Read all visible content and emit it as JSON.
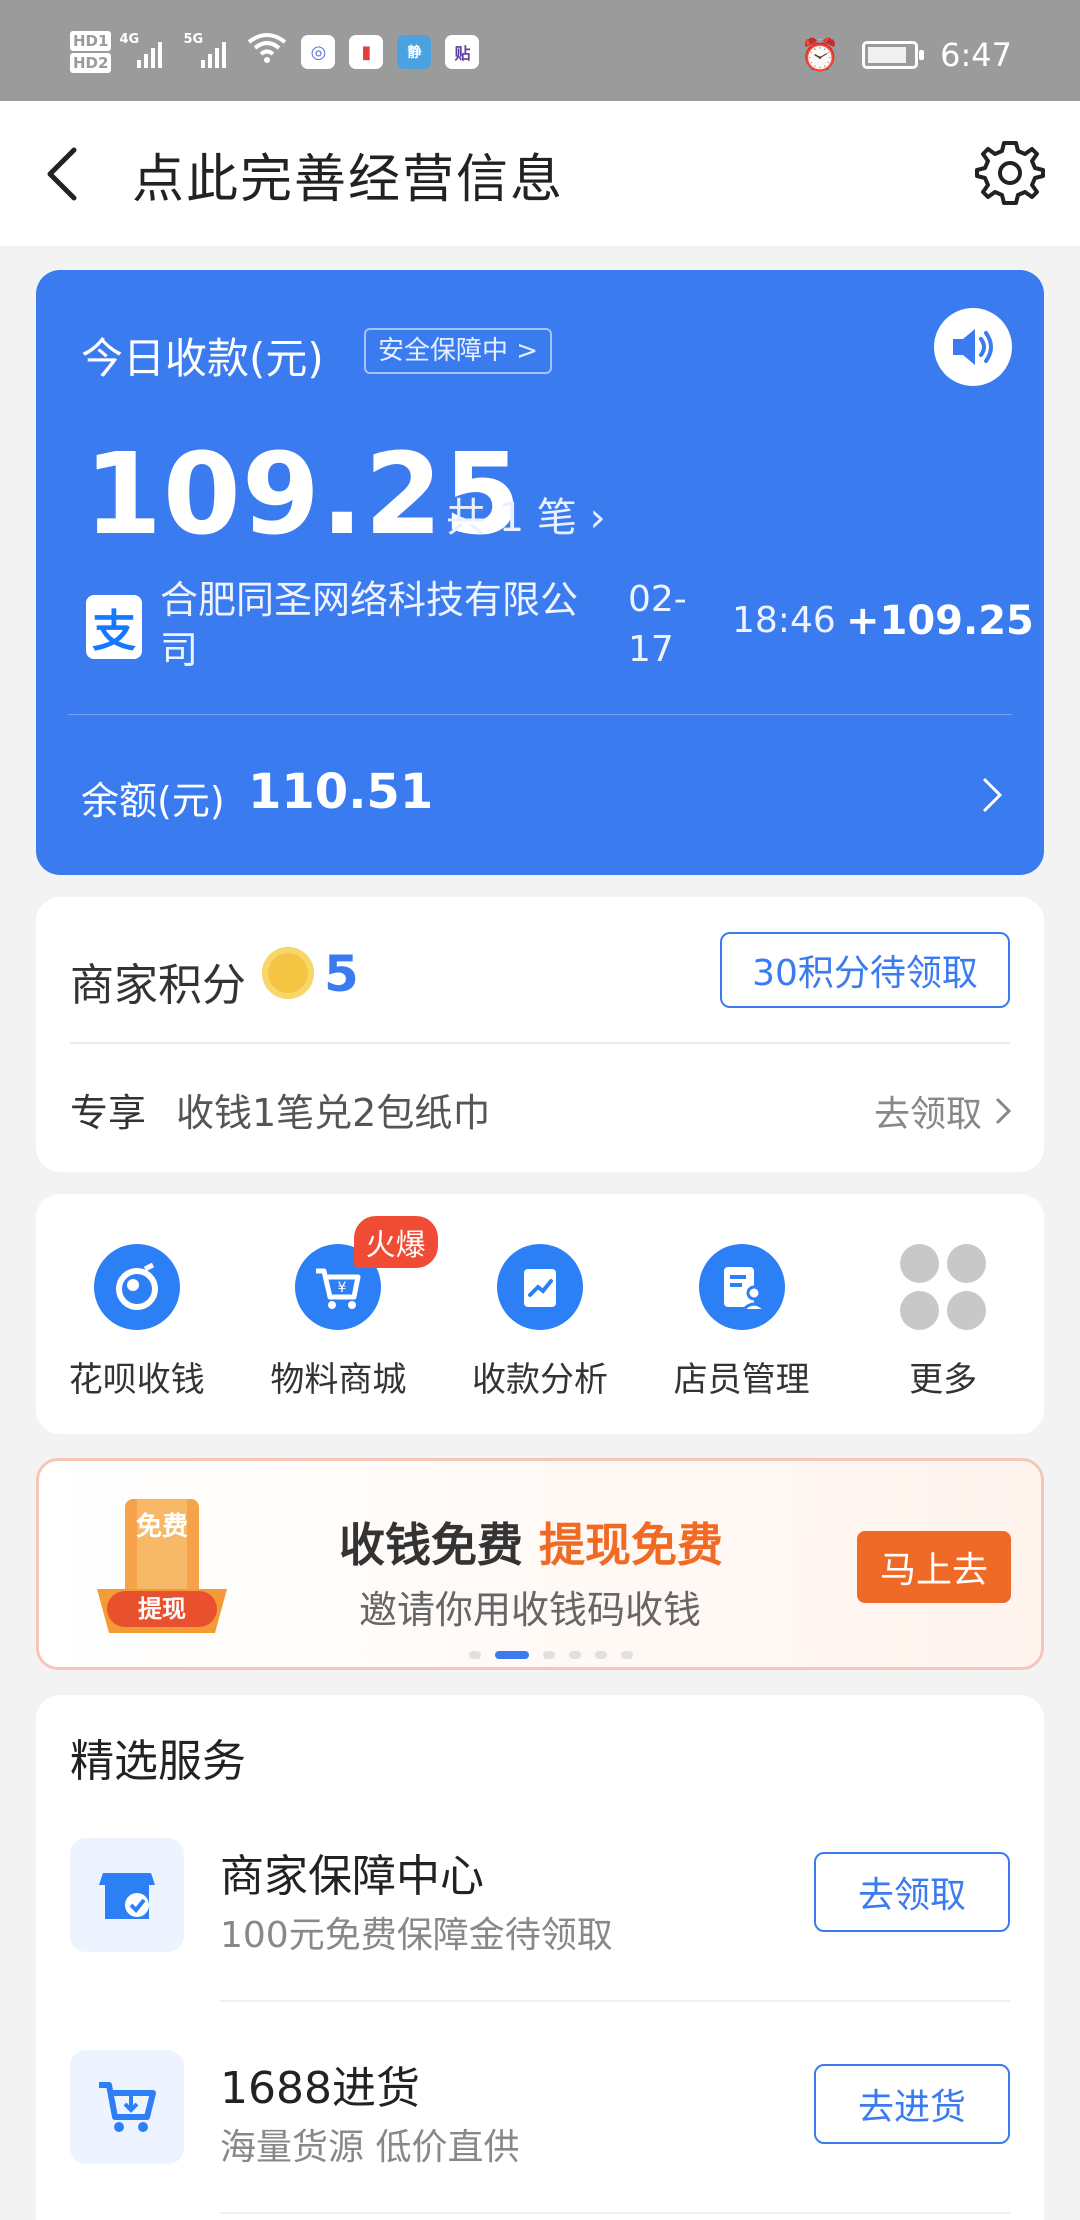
{
  "status_bar": {
    "hd1": "HD1",
    "hd2": "HD2",
    "sig1": "4G",
    "sig2": "5G",
    "app_icons": [
      "◎",
      "▮",
      "静",
      "贴"
    ],
    "time": "6:47"
  },
  "header": {
    "title": "点此完善经营信息"
  },
  "today": {
    "label": "今日收款(元)",
    "safe_badge": "安全保障中 >",
    "amount": "109.25",
    "count": "共 1 笔 ›",
    "tx_icon": "支",
    "tx_name": "合肥同圣网络科技有限公司",
    "tx_date": "02-17",
    "tx_time": "18:46",
    "tx_amount": "+109.25",
    "balance_label": "余额(元)",
    "balance_value": "110.51"
  },
  "points": {
    "label": "商家积分",
    "value": "5",
    "claim_button": "30积分待领取",
    "exclusive_label": "专享",
    "exclusive_text": "收钱1笔兑2包纸巾",
    "exclusive_link": "去领取"
  },
  "quick_actions": [
    {
      "label": "花呗收钱",
      "icon": "huabei-icon"
    },
    {
      "label": "物料商城",
      "icon": "shop-cart-icon",
      "badge": "火爆"
    },
    {
      "label": "收款分析",
      "icon": "analysis-icon"
    },
    {
      "label": "店员管理",
      "icon": "staff-icon"
    },
    {
      "label": "更多",
      "icon": "more-grid-icon"
    }
  ],
  "banner": {
    "icon_text_top": "免费",
    "icon_text_bottom": "提现",
    "title_a": "收钱免费",
    "title_b": "提现免费",
    "subtitle": "邀请你用收钱码收钱",
    "button": "马上去"
  },
  "services": {
    "title": "精选服务",
    "items": [
      {
        "name": "商家保障中心",
        "desc": "100元免费保障金待领取",
        "button": "去领取",
        "icon": "store-shield-icon"
      },
      {
        "name": "1688进货",
        "desc": "海量货源 低价直供",
        "button": "去进货",
        "icon": "cart-download-icon"
      }
    ]
  },
  "colors": {
    "primary": "#3b7bf0",
    "accent": "#ee6a26",
    "hot_badge": "#f04b35"
  }
}
